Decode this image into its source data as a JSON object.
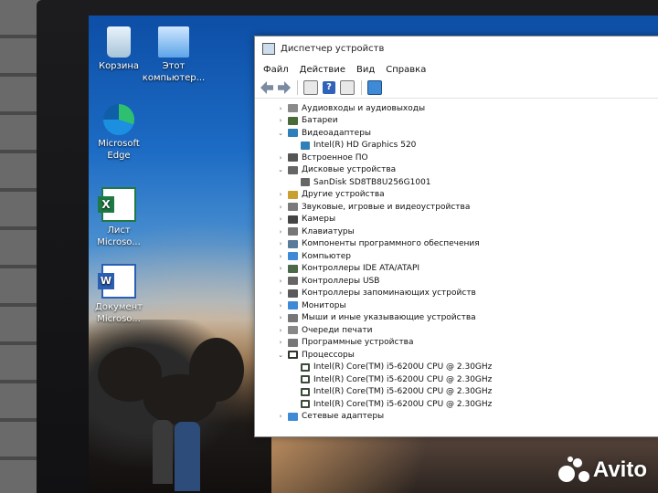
{
  "desktop": {
    "icons": [
      {
        "label_1": "Корзина",
        "label_2": ""
      },
      {
        "label_1": "Этот",
        "label_2": "компьютер..."
      },
      {
        "label_1": "Microsoft",
        "label_2": "Edge"
      },
      {
        "label_1": "Лист",
        "label_2": "Microso..."
      },
      {
        "label_1": "Документ",
        "label_2": "Microso..."
      }
    ]
  },
  "window": {
    "title": "Диспетчер устройств",
    "menu": [
      "Файл",
      "Действие",
      "Вид",
      "Справка"
    ],
    "toolbar_icons": [
      "back-arrow-icon",
      "forward-arrow-icon",
      "properties-icon",
      "help-icon",
      "view-icon",
      "scan-monitor-icon"
    ],
    "tree": [
      {
        "label": "Аудиовходы и аудиовыходы",
        "chevron": "›",
        "icon": "speaker-icon",
        "color": "#8a8a8a"
      },
      {
        "label": "Батареи",
        "chevron": "›",
        "icon": "battery-icon",
        "color": "#4a6a3a"
      },
      {
        "label": "Видеоадаптеры",
        "chevron": "⌄",
        "icon": "display-adapter-icon",
        "color": "#2f7fb8"
      },
      {
        "label": "Intel(R) HD Graphics 520",
        "chevron": "",
        "icon": "display-adapter-icon",
        "color": "#2f7fb8",
        "child": true
      },
      {
        "label": "Встроенное ПО",
        "chevron": "›",
        "icon": "firmware-icon",
        "color": "#555"
      },
      {
        "label": "Дисковые устройства",
        "chevron": "⌄",
        "icon": "disk-icon",
        "color": "#666"
      },
      {
        "label": "SanDisk SD8TB8U256G1001",
        "chevron": "",
        "icon": "disk-icon",
        "color": "#666",
        "child": true
      },
      {
        "label": "Другие устройства",
        "chevron": "›",
        "icon": "unknown-device-icon",
        "color": "#c8a030"
      },
      {
        "label": "Звуковые, игровые и видеоустройства",
        "chevron": "›",
        "icon": "sound-icon",
        "color": "#7a7a7a"
      },
      {
        "label": "Камеры",
        "chevron": "›",
        "icon": "camera-icon",
        "color": "#444"
      },
      {
        "label": "Клавиатуры",
        "chevron": "›",
        "icon": "keyboard-icon",
        "color": "#777"
      },
      {
        "label": "Компоненты программного обеспечения",
        "chevron": "›",
        "icon": "software-component-icon",
        "color": "#5a7a9a"
      },
      {
        "label": "Компьютер",
        "chevron": "›",
        "icon": "computer-icon",
        "color": "#3f8ad6"
      },
      {
        "label": "Контроллеры IDE ATA/ATAPI",
        "chevron": "›",
        "icon": "ide-controller-icon",
        "color": "#4a6a4a"
      },
      {
        "label": "Контроллеры USB",
        "chevron": "›",
        "icon": "usb-icon",
        "color": "#666"
      },
      {
        "label": "Контроллеры запоминающих устройств",
        "chevron": "›",
        "icon": "storage-controller-icon",
        "color": "#5a5a5a"
      },
      {
        "label": "Мониторы",
        "chevron": "›",
        "icon": "monitor-icon",
        "color": "#3f8ad6"
      },
      {
        "label": "Мыши и иные указывающие устройства",
        "chevron": "›",
        "icon": "mouse-icon",
        "color": "#777"
      },
      {
        "label": "Очереди печати",
        "chevron": "›",
        "icon": "printer-icon",
        "color": "#888"
      },
      {
        "label": "Программные устройства",
        "chevron": "›",
        "icon": "software-device-icon",
        "color": "#777"
      },
      {
        "label": "Процессоры",
        "chevron": "⌄",
        "icon": "processor-icon",
        "color": "#30382e"
      },
      {
        "label": "Intel(R) Core(TM) i5-6200U CPU @ 2.30GHz",
        "chevron": "",
        "icon": "processor-icon",
        "color": "#3c4a3a",
        "child": true
      },
      {
        "label": "Intel(R) Core(TM) i5-6200U CPU @ 2.30GHz",
        "chevron": "",
        "icon": "processor-icon",
        "color": "#3c4a3a",
        "child": true
      },
      {
        "label": "Intel(R) Core(TM) i5-6200U CPU @ 2.30GHz",
        "chevron": "",
        "icon": "processor-icon",
        "color": "#3c4a3a",
        "child": true
      },
      {
        "label": "Intel(R) Core(TM) i5-6200U CPU @ 2.30GHz",
        "chevron": "",
        "icon": "processor-icon",
        "color": "#3c4a3a",
        "child": true
      },
      {
        "label": "Сетевые адаптеры",
        "chevron": "›",
        "icon": "network-adapter-icon",
        "color": "#3f8ad6"
      }
    ]
  },
  "watermark": {
    "text": "Avito"
  }
}
